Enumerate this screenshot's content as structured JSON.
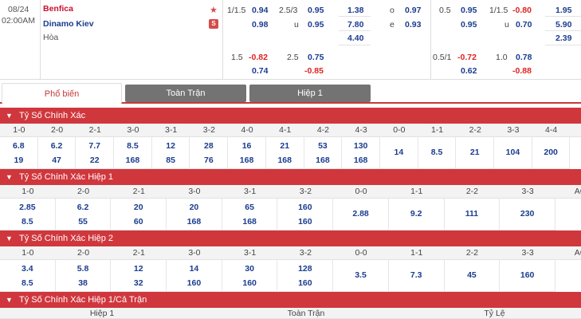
{
  "match": {
    "date": "08/24",
    "time": "02:00AM",
    "home": "Benfica",
    "away": "Dinamo Kiev",
    "draw_label": "Hòa",
    "live_badge": "S",
    "ft_hdp": {
      "line1": "1/1.5",
      "home": "0.94",
      "away": "0.98",
      "line2": "1.5",
      "home2": "-0.82",
      "away2": "0.74"
    },
    "ft_ou": {
      "line1": "2.5/3",
      "over": "0.95",
      "u_label": "u",
      "under": "0.95",
      "line2": "2.5",
      "over2": "0.75",
      "under2": "-0.85"
    },
    "ft_1x2": {
      "home": "1.38",
      "away": "7.80",
      "draw": "4.40"
    },
    "ft_oe": {
      "o_label": "o",
      "odd": "0.97",
      "e_label": "e",
      "even": "0.93"
    },
    "h1_hdp": {
      "line1": "0.5",
      "home": "0.95",
      "away": "0.95",
      "line2": "0.5/1",
      "home2": "-0.72",
      "away2": "0.62"
    },
    "h1_ou": {
      "line1": "1/1.5",
      "over": "-0.80",
      "u_label": "u",
      "under": "0.70",
      "line2": "1.0",
      "over2": "0.78",
      "under2": "-0.88"
    },
    "h1_1x2": {
      "home": "1.95",
      "away": "5.90",
      "draw": "2.39"
    }
  },
  "tabs": [
    {
      "label": "Phổ biến"
    },
    {
      "label": "Toàn Trận"
    },
    {
      "label": "Hiệp 1"
    }
  ],
  "sections": {
    "cs_ft": {
      "title": "Tỷ Số Chính Xác",
      "headers": [
        "1-0",
        "2-0",
        "2-1",
        "3-0",
        "3-1",
        "3-2",
        "4-0",
        "4-1",
        "4-2",
        "4-3",
        "0-0",
        "1-1",
        "2-2",
        "3-3",
        "4-4"
      ],
      "row1": [
        "6.8",
        "6.2",
        "7.7",
        "8.5",
        "12",
        "28",
        "16",
        "21",
        "53",
        "130",
        "14",
        "8.5",
        "21",
        "104",
        "200"
      ],
      "row2": [
        "19",
        "47",
        "22",
        "168",
        "85",
        "76",
        "168",
        "168",
        "168",
        "168"
      ]
    },
    "cs_h1": {
      "title": "Tỷ Số Chính Xác Hiệp 1",
      "headers": [
        "1-0",
        "2-0",
        "2-1",
        "3-0",
        "3-1",
        "3-2",
        "0-0",
        "1-1",
        "2-2",
        "3-3",
        "AOS"
      ],
      "row1": [
        "2.85",
        "6.2",
        "20",
        "20",
        "65",
        "160",
        "2.88",
        "9.2",
        "111",
        "230"
      ],
      "row2": [
        "8.5",
        "55",
        "60",
        "168",
        "168",
        "160"
      ]
    },
    "cs_h2": {
      "title": "Tỷ Số Chính Xác Hiệp 2",
      "headers": [
        "1-0",
        "2-0",
        "2-1",
        "3-0",
        "3-1",
        "3-2",
        "0-0",
        "1-1",
        "2-2",
        "3-3",
        "AOS"
      ],
      "row1": [
        "3.4",
        "5.8",
        "12",
        "14",
        "30",
        "128",
        "3.5",
        "7.3",
        "45",
        "160"
      ],
      "row2": [
        "8.5",
        "38",
        "32",
        "160",
        "160",
        "160"
      ]
    },
    "htft": {
      "title": "Tỷ Số Chính Xác Hiệp 1/Cả Trận",
      "headers": [
        "Hiệp 1",
        "Toàn Trận",
        "Tỷ Lệ"
      ]
    }
  }
}
